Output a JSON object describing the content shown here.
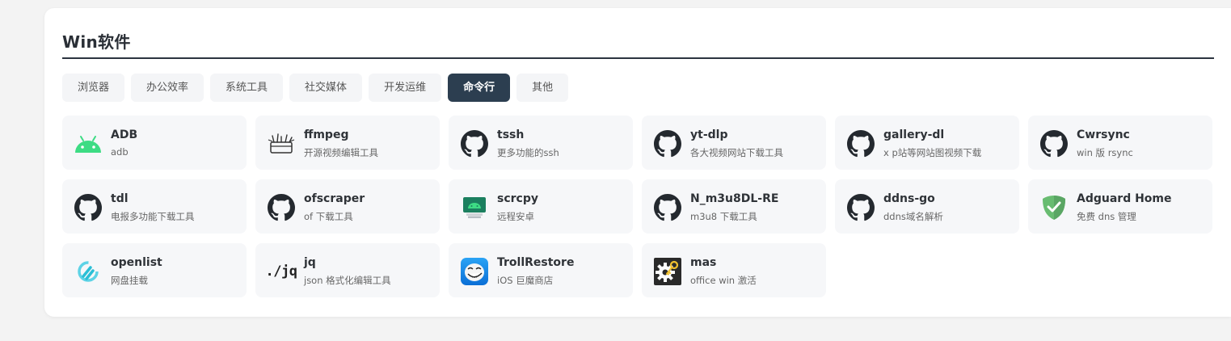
{
  "section": {
    "title": "Win软件"
  },
  "tabs": [
    {
      "label": "浏览器",
      "active": false
    },
    {
      "label": "办公效率",
      "active": false
    },
    {
      "label": "系统工具",
      "active": false
    },
    {
      "label": "社交媒体",
      "active": false
    },
    {
      "label": "开发运维",
      "active": false
    },
    {
      "label": "命令行",
      "active": true
    },
    {
      "label": "其他",
      "active": false
    }
  ],
  "items": [
    {
      "name": "ADB",
      "desc": "adb",
      "icon": "android-icon"
    },
    {
      "name": "ffmpeg",
      "desc": "开源视频编辑工具",
      "icon": "ffmpeg-icon"
    },
    {
      "name": "tssh",
      "desc": "更多功能的ssh",
      "icon": "github-icon"
    },
    {
      "name": "yt-dlp",
      "desc": "各大视频网站下载工具",
      "icon": "github-icon"
    },
    {
      "name": "gallery-dl",
      "desc": "x p站等网站图视频下载",
      "icon": "github-icon"
    },
    {
      "name": "Cwrsync",
      "desc": "win 版 rsync",
      "icon": "github-icon"
    },
    {
      "name": "tdl",
      "desc": "电报多功能下载工具",
      "icon": "github-icon"
    },
    {
      "name": "ofscraper",
      "desc": "of 下载工具",
      "icon": "github-icon"
    },
    {
      "name": "scrcpy",
      "desc": "远程安卓",
      "icon": "scrcpy-icon"
    },
    {
      "name": "N_m3u8DL-RE",
      "desc": "m3u8 下载工具",
      "icon": "github-icon"
    },
    {
      "name": "ddns-go",
      "desc": "ddns域名解析",
      "icon": "github-icon"
    },
    {
      "name": "Adguard Home",
      "desc": "免费 dns 管理",
      "icon": "adguard-shield-icon"
    },
    {
      "name": "openlist",
      "desc": "网盘挂载",
      "icon": "openlist-icon"
    },
    {
      "name": "jq",
      "desc": "json 格式化编辑工具",
      "icon": "jq-icon",
      "icon_text": "./jq"
    },
    {
      "name": "TrollRestore",
      "desc": "iOS 巨魔商店",
      "icon": "trollface-icon"
    },
    {
      "name": "mas",
      "desc": "office win 激活",
      "icon": "mas-gear-key-icon"
    }
  ],
  "colors": {
    "active_tab": "#2c3e50",
    "android": "#3ddc84",
    "adguard": "#68bc71"
  }
}
